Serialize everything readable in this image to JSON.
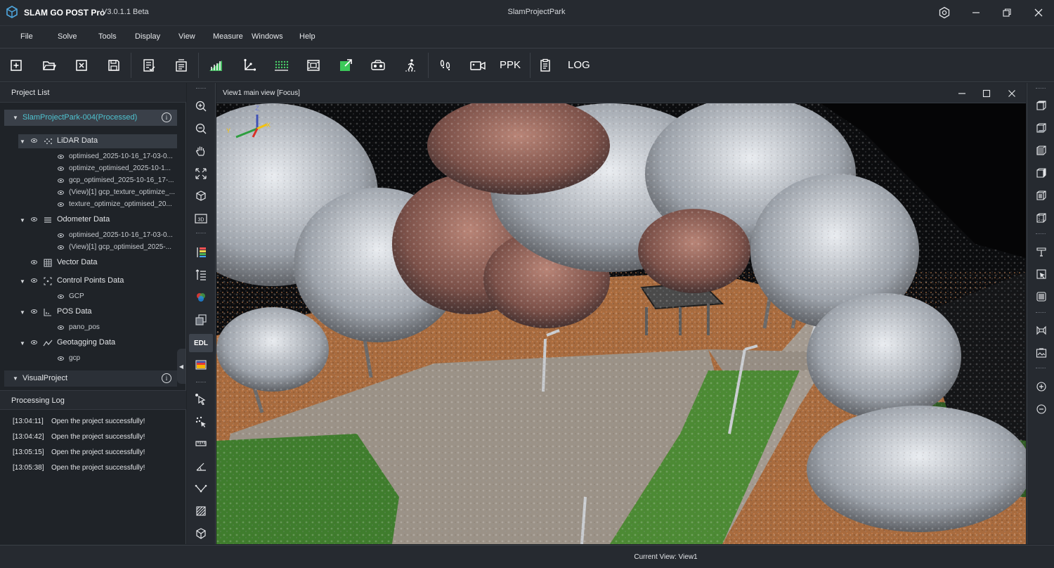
{
  "app": {
    "name": "SLAM GO POST Pro",
    "version": "V3.0.1.1 Beta",
    "window_title": "SlamProjectPark"
  },
  "window_controls": [
    "settings-icon",
    "minimize-icon",
    "restore-icon",
    "close-icon"
  ],
  "menu": [
    "File",
    "Solve",
    "Tools",
    "Display",
    "View",
    "Measure",
    "Windows",
    "Help"
  ],
  "toolbar": {
    "text_buttons": {
      "ppk": "PPK",
      "log": "LOG"
    },
    "icons": [
      "new-project-icon",
      "open-project-icon",
      "close-project-icon",
      "save-icon",
      "task-list-icon",
      "batch-process-icon",
      "point-cloud-processing-icon",
      "coordinate-transform-icon",
      "grid-filter-icon",
      "crop-icon",
      "export-icon",
      "vr-view-icon",
      "walk-mode-icon",
      "footprint-icon",
      "video-icon",
      "ppk-button",
      "report-icon",
      "log-button"
    ]
  },
  "left_panel": {
    "project_list_title": "Project List",
    "project_name": "SlamProjectPark-004(Processed)",
    "tree": [
      {
        "label": "LiDAR Data",
        "children": [
          "optimised_2025-10-16_17-03-0...",
          "optimize_optimised_2025-10-1...",
          "gcp_optimised_2025-10-16_17-...",
          "(View)[1] gcp_texture_optimize_...",
          "texture_optimize_optimised_20..."
        ]
      },
      {
        "label": "Odometer Data",
        "children": [
          "optimised_2025-10-16_17-03-0...",
          "(View)[1] gcp_optimised_2025-..."
        ]
      },
      {
        "label": "Vector Data",
        "children": []
      },
      {
        "label": "Control Points Data",
        "children": [
          "GCP"
        ]
      },
      {
        "label": "POS Data",
        "children": [
          "pano_pos"
        ]
      },
      {
        "label": "Geotagging Data",
        "children": [
          "gcp"
        ]
      }
    ],
    "visual_project_title": "VisualProject",
    "processing_log_title": "Processing Log",
    "log": [
      {
        "time": "[13:04:11]",
        "msg": "Open the project successfully!"
      },
      {
        "time": "[13:04:42]",
        "msg": "Open the project successfully!"
      },
      {
        "time": "[13:05:15]",
        "msg": "Open the project successfully!"
      },
      {
        "time": "[13:05:38]",
        "msg": "Open the project successfully!"
      }
    ]
  },
  "tools_column": {
    "edl_label": "EDL",
    "icons": [
      "zoom-in-icon",
      "zoom-out-icon",
      "pan-hand-icon",
      "fit-view-icon",
      "cube-view-icon",
      "3d-view-icon",
      "color-ramp-icon",
      "elevation-icon",
      "rgb-color-icon",
      "layers-icon",
      "edl-button",
      "intensity-color-icon",
      "select-cursor-icon",
      "point-pick-icon",
      "measure-distance-icon",
      "measure-angle-icon",
      "measure-profile-icon",
      "measure-area-icon",
      "measure-volume-icon"
    ]
  },
  "view": {
    "title": "View1 main view [Focus]",
    "axis_labels": {
      "z": "Z",
      "y": "Y",
      "x": "X"
    }
  },
  "right_column": {
    "icons": [
      "view-top-icon",
      "view-bottom-icon",
      "view-front-icon",
      "view-back-icon",
      "view-left-icon",
      "view-right-icon",
      "section-tool-icon",
      "clip-box-icon",
      "clip-plane-icon",
      "bounding-box-icon",
      "screenshot-icon",
      "zoom-in-icon",
      "zoom-out-icon"
    ]
  },
  "status": {
    "text": "Current View: View1"
  },
  "colors": {
    "accent_project": "#4fc3d0",
    "panel_bg": "#1f2328",
    "bar_bg": "#262a30"
  }
}
